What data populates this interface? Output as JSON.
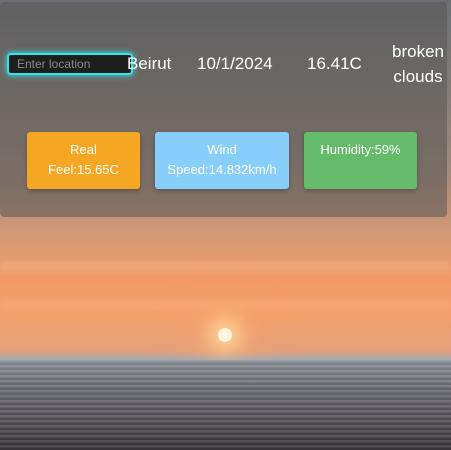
{
  "search": {
    "placeholder": "Enter location"
  },
  "weather": {
    "city": "Beirut",
    "date": "10/1/2024",
    "temperature": "16.41C",
    "description_line1": "broken",
    "description_line2": "clouds"
  },
  "cards": {
    "real_feel": {
      "line1": "Real",
      "line2": "Feel:15.65C",
      "color": "#f5a623"
    },
    "wind": {
      "line1": "Wind",
      "line2": "Speed:14.832km/h",
      "color": "#87cefa"
    },
    "humidity": {
      "line1": "Humidity:59%",
      "color": "#66bb6a"
    }
  }
}
